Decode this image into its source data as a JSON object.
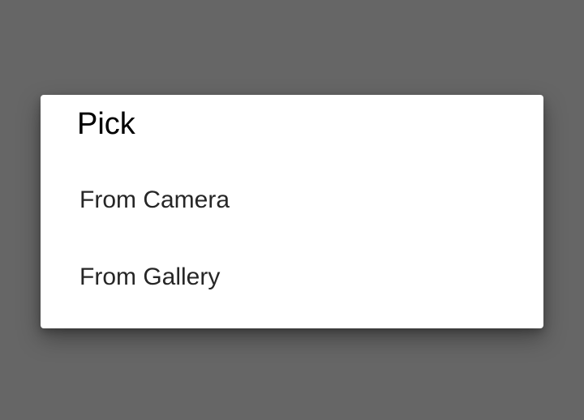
{
  "dialog": {
    "title": "Pick",
    "options": [
      {
        "label": "From Camera"
      },
      {
        "label": "From Gallery"
      }
    ]
  },
  "colors": {
    "scrim": "#666666",
    "dialog_background": "#ffffff",
    "title_text": "#000000",
    "option_text": "#262626"
  }
}
